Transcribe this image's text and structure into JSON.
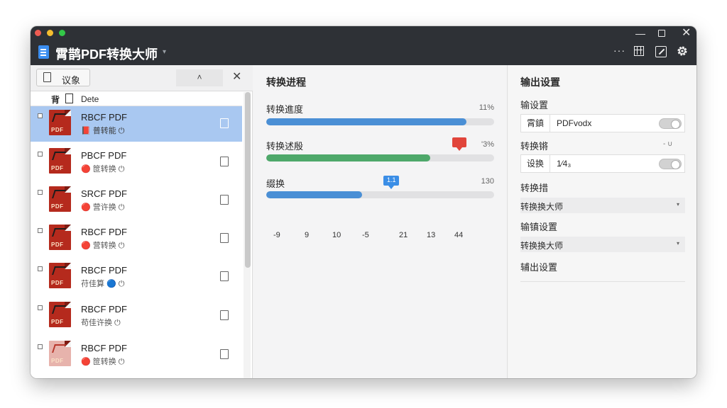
{
  "app": {
    "title": "霄鹊PDF转换大师",
    "title_caret": "▾",
    "more": "···",
    "close": "✕",
    "minimize": "—"
  },
  "left": {
    "objects_button": "议象",
    "up_button": "˄",
    "close_button": "✕",
    "col_header_1": "背",
    "col_header_2": "Dete",
    "files": [
      {
        "name": "RBCF PDF",
        "meta": "📕 普转能 ⏻",
        "selected": true,
        "pdf_label": "PDF",
        "variant": "dark"
      },
      {
        "name": "PBCF PDF",
        "meta": "🔴 笸转换 ⏻",
        "selected": false,
        "pdf_label": "PDF",
        "variant": "dark"
      },
      {
        "name": "SRCF PDF",
        "meta": "🔴 营许换 ⏻",
        "selected": false,
        "pdf_label": "PDF",
        "variant": "dark"
      },
      {
        "name": "RBCF PDF",
        "meta": "🔴 营转换 ⏻",
        "selected": false,
        "pdf_label": "PDF",
        "variant": "dark"
      },
      {
        "name": "RBCF PDF",
        "meta": "苻佳算 🔵 ⏻",
        "selected": false,
        "pdf_label": "PDF",
        "variant": "dark"
      },
      {
        "name": "RBCF PDF",
        "meta": "苟佳许换 ⏻",
        "selected": false,
        "pdf_label": "PDF",
        "variant": "dark"
      },
      {
        "name": "RBCF PDF",
        "meta": "🔴 笸转换 ⏻",
        "selected": false,
        "pdf_label": "PDF",
        "variant": "light"
      }
    ]
  },
  "middle": {
    "title": "转换进程",
    "progress": [
      {
        "label": "转换進度",
        "value_text": "11%",
        "fraction": 0.88,
        "color": "blue"
      },
      {
        "label": "转换述殷",
        "value_text": "'3%",
        "fraction": 0.72,
        "color": "green"
      },
      {
        "label": "缀换",
        "value_text": "130",
        "fraction": 0.42,
        "color": "blue"
      }
    ],
    "bubble_text": "1.1",
    "ticks": [
      "-9",
      "9",
      "10",
      "-5",
      "21",
      "13",
      "44"
    ]
  },
  "right": {
    "title": "输出设置",
    "section1": "输设置",
    "field1": {
      "key": "霄鎮",
      "value": "PDFvodx"
    },
    "section2": "转换锵",
    "section2_aux": "- ∪",
    "field2": {
      "key": "设换",
      "value": "1⁄4₃"
    },
    "section3": "转换措",
    "select1": "转换换大师",
    "section4": "输镇设置",
    "select2": "转换换大师",
    "section5": "辅出设置",
    "caret": "▾"
  }
}
